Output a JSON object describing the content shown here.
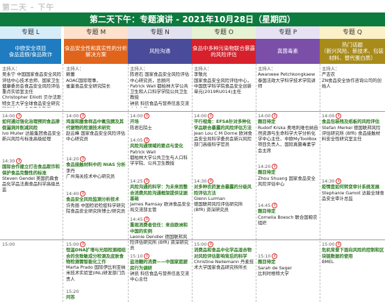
{
  "day_title": "第二天 - 下午",
  "banner": "第二天下午：专题演讲 - 2021年10月28日（星期四）",
  "tracks": {
    "L": {
      "header": "专题 L",
      "topic": "中欧安全项目\n食品造假/食品欺诈"
    },
    "M": {
      "header": "专题 M",
      "topic": "食品安全性和真实性的分析解决方案"
    },
    "N": {
      "header": "专题 N",
      "topic": "风险沟通"
    },
    "O": {
      "header": "专题 O",
      "topic": "食品中多种污染物联合暴露的风险评估"
    },
    "P": {
      "header": "专题 P",
      "topic": "真菌毒素"
    },
    "Q": {
      "header": "专题 Q",
      "topic": "热门话题\n（新兴风险、新技术、包装材料、替代蛋白质）"
    }
  },
  "chairs": {
    "L": {
      "label": "主持人：",
      "text": "吴永宁 中国国家食品安全风险评估中心技术总师、国家卫生健康委员会食品安全风险评估重点实验室主任\nChristopher Elliott 贝尔法斯特女王大学全球食品安全研究所创始人，食品安全教授"
    },
    "M": {
      "label": "主持人：",
      "text": "赖蕾\nAOAC国际理事，\n雀巢食品安全研究院长"
    },
    "N": {
      "label": "主持人：",
      "text": "陈君石 国家食品安全风险评估中心研究员，总顾问\nPatrick Wall 都柏林大学公共卫生和人口科学学院公共卫生教授\n钟凯 科信食品与营养信息交流中心主任"
    },
    "O": {
      "label": "主持人：",
      "text": "李敬光\n国家食品安全风险评估中心，中国医学科学院食品安全创新单元(2019RU014)主任"
    },
    "P": {
      "label": "主持人：",
      "text": "Awanwee Petchkongkaew\n泰国法政大学科学技术学院讲师"
    },
    "Q": {
      "label": "主持人：",
      "text": "严志农\nZN食品安全协作咨询公司的创始人"
    }
  },
  "sessions": {
    "L": [
      {
        "time": "14:00",
        "title": "如何通过强化治理预同食品掺假漏洞并削减风险",
        "speaker": "Ivo Muller 达能集团食品安全新兴风险与标准高级经理"
      },
      {
        "time": "14:30",
        "title": "国际合作建立打击食品欺诈和保护食品完整性的标准",
        "speaker": "Steven Gendel 美国药典食品化学品法典食品科学高级总监"
      },
      {
        "time": "15:00",
        "title": "",
        "speaker": ""
      }
    ],
    "M": [
      {
        "time": "14:00",
        "title": "鸡蛋和膳食样品中氟虫腈及其代谢物的检测技术研究",
        "speaker": "赵云峰 国家食品安全风险评估中心研究员"
      },
      {
        "time": "14:20",
        "title": "食品接触材料中的 NIAS 分析",
        "speaker": "李丹\n广州海关技术中心研究员"
      },
      {
        "time": "14:40",
        "title": "食品安全风险监测分析技术",
        "speaker": "许秀丽 中国检验检疫科学研究院食品安全研究所博士/研究员"
      },
      {
        "time": "15:00",
        "title": "恒温DNA扩增与光阻检测相结合的含致敏成分检测及皮肤食物检测需智能化工作",
        "speaker": "Marta Prado 国际伊比利亚纳米技术实验室(INL)研发部门负责人"
      },
      {
        "time": "15:20",
        "title": "问答",
        "speaker": ""
      }
    ],
    "N": [
      {
        "time": "14:00",
        "title": "开场",
        "speaker": "陈君石院士"
      },
      {
        "time": "14:05",
        "title": "风险沟通领域的要点与变化",
        "speaker": "Patrick Wall\n都柏林大学公共卫生与人口科学学院、公共卫生教授"
      },
      {
        "time": "14:25",
        "title": "风险沟通的科学：为未来而整合消费风险沟通框架提供证据基础",
        "speaker": "James Ramsay 欧洲食品安全局交流部主管"
      },
      {
        "time": "14:45",
        "title": "重视消费者信任：来自欧洲和中国的实例",
        "speaker": "Leonie Dendler 德国联邦风险评估研究所 (BfR) 资深研究员"
      },
      {
        "time": "15:10",
        "title": "盐池糖的消费——中国家庭厨房行为调研",
        "speaker": "钟凯 科信食品与营养信息交流中心主任"
      }
    ],
    "O": [
      {
        "time": "14:00",
        "title": "平行视角：EFSA针对多种化学品联合暴露的风险评估方法",
        "speaker": "Jean Lou C M Dorne 欧洲食品安全局科学委员会新兴风险部门高级科学官员"
      },
      {
        "time": "14:30",
        "title": "对多种农药复合暴露的分级风险评估方法",
        "speaker": "Glenn Lurman\n德国联邦风险评估研究所 (BfR) 资深研究员"
      },
      {
        "time": "15:00",
        "title": "消费品和食品中化学品混合物对风险评估影响背后的科学",
        "speaker": "Christine Nellemann 丹麦技术大学国家食品研究所所长"
      }
    ],
    "P": [
      {
        "time": "14:00",
        "title": "题目待定",
        "speaker": "Rudolf Krska 奥地利维也纳自然资源与生命科学大学分析化学中心主任、中欧MyToolBox项目负责人、国际真菌毒素学会主席"
      },
      {
        "time": "14:20",
        "title": "题目待定",
        "speaker": "Zhou Shuang 国家食品安全风险评估中心"
      },
      {
        "time": "14:45",
        "title": "题目待定",
        "speaker": "Cornelia Boesch 联合国粮农组织"
      },
      {
        "time": "15:10",
        "title": "题目待定",
        "speaker": "Sarah de Seger\n比利时根特大学"
      }
    ],
    "Q": [
      {
        "time": "14:00",
        "title": "食品包装残及纸板的风险评估",
        "speaker": "Stefan Merkel 德国联邦风险评估研究所 (BfR) 食品接触材料安全性研究室主任"
      },
      {
        "time": "14:30",
        "title": "疫情是如何转变审计系统发展",
        "speaker": "Stephanie Gamot 达能全球食品安全审计总监"
      },
      {
        "time": "15:00",
        "title": "危机背景下面向风险的控制和区块链数据的使用",
        "speaker": "BMEL"
      }
    ]
  }
}
